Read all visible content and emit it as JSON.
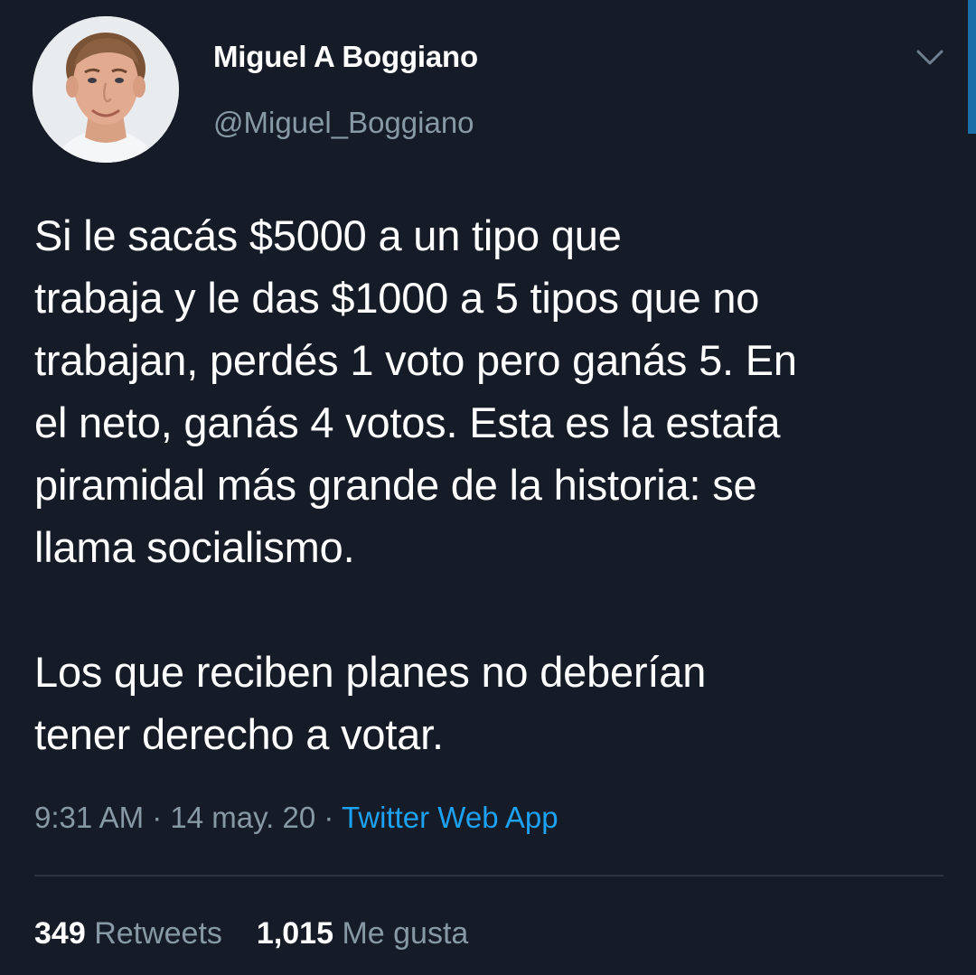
{
  "author": {
    "name": "Miguel A Boggiano",
    "handle": "@Miguel_Boggiano"
  },
  "icons": {
    "menu_caret": "chevron-down-icon",
    "avatar": "profile-photo"
  },
  "tweet": {
    "paragraph_1": "Si le sacás $5000 a un tipo que\ntrabaja y le das $1000 a 5 tipos que no\ntrabajan, perdés 1 voto pero ganás 5. En\nel neto, ganás 4 votos. Esta es la estafa\npiramidal más grande de la historia: se\nllama socialismo.",
    "paragraph_2": "Los que reciben planes no deberían\ntener derecho a votar."
  },
  "meta": {
    "time": "9:31 AM",
    "separator": " · ",
    "date": "14 may. 20",
    "source": "Twitter Web App"
  },
  "stats": {
    "retweets_count": "349",
    "retweets_label": "Retweets",
    "likes_count": "1,015",
    "likes_label": "Me gusta"
  },
  "colors": {
    "background": "#151c27",
    "text": "#ffffff",
    "muted": "#8899a6",
    "link": "#1da1f2",
    "divider": "#2b3440"
  }
}
